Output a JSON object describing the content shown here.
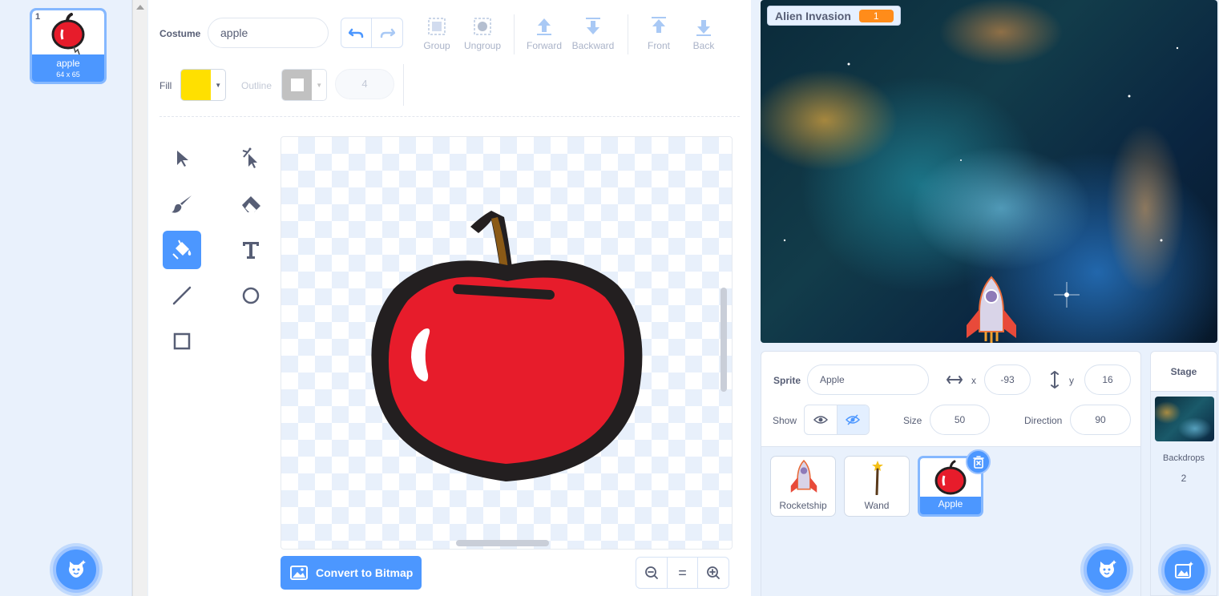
{
  "costume_list": {
    "items": [
      {
        "number": "1",
        "name": "apple",
        "dimensions": "64 x 65",
        "selected": true
      }
    ],
    "add_icon": "cat-plus-icon"
  },
  "paint_editor": {
    "costume_label": "Costume",
    "costume_name": "apple",
    "toolbar": {
      "undo_icon": "undo-icon",
      "redo_icon": "redo-icon",
      "group": "Group",
      "ungroup": "Ungroup",
      "forward": "Forward",
      "backward": "Backward",
      "front": "Front",
      "back": "Back"
    },
    "fill_label": "Fill",
    "fill_color": "#ffe000",
    "outline_label": "Outline",
    "outline_color": "#a8a8a8",
    "outline_width": "4",
    "tools": [
      "select-icon",
      "reshape-icon",
      "brush-icon",
      "eraser-icon",
      "fill-icon",
      "text-icon",
      "line-icon",
      "circle-icon",
      "rectangle-icon"
    ],
    "active_tool": "fill-icon",
    "convert_button": "Convert to Bitmap",
    "zoom": {
      "zoom_out": "zoom-out-icon",
      "reset": "=",
      "zoom_in": "zoom-in-icon"
    }
  },
  "stage": {
    "monitor_label": "Alien Invasion",
    "monitor_value": "1"
  },
  "sprite_info": {
    "sprite_label": "Sprite",
    "sprite_name": "Apple",
    "x_label": "x",
    "x_value": "-93",
    "y_label": "y",
    "y_value": "16",
    "show_label": "Show",
    "size_label": "Size",
    "size_value": "50",
    "direction_label": "Direction",
    "direction_value": "90"
  },
  "sprites": [
    {
      "name": "Rocketship",
      "selected": false
    },
    {
      "name": "Wand",
      "selected": false
    },
    {
      "name": "Apple",
      "selected": true
    }
  ],
  "stage_panel": {
    "title": "Stage",
    "backdrops_label": "Backdrops",
    "backdrops_count": "2"
  },
  "colors": {
    "accent": "#4c97ff",
    "monitor_value_bg": "#ff8c1a",
    "apple_red": "#e71c2b"
  }
}
